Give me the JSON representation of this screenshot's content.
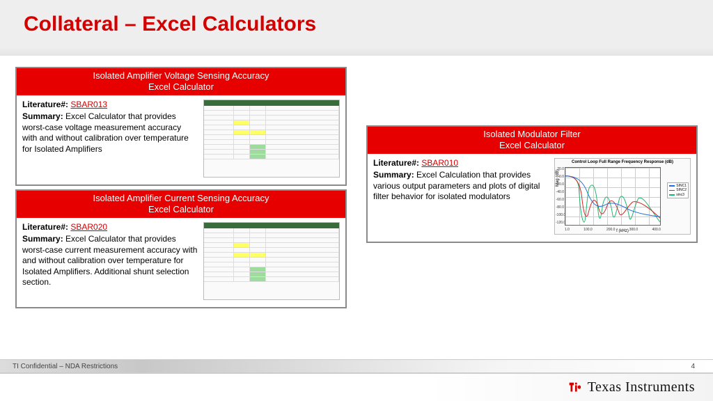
{
  "slide": {
    "title": "Collateral – Excel Calculators",
    "confidential": "TI Confidential – NDA Restrictions",
    "page_number": "4",
    "brand": "Texas Instruments"
  },
  "cards": [
    {
      "header_line1": "Isolated Amplifier Voltage Sensing Accuracy",
      "header_line2": "Excel Calculator",
      "literature_label": "Literature#:",
      "literature_id": "SBAR013",
      "summary_label": "Summary:",
      "summary_text": "Excel Calculator that provides worst-case voltage measurement accuracy with and without calibration over temperature for Isolated Amplifiers"
    },
    {
      "header_line1": "Isolated Amplifier Current Sensing Accuracy",
      "header_line2": "Excel Calculator",
      "literature_label": "Literature#:",
      "literature_id": "SBAR020",
      "summary_label": "Summary:",
      "summary_text": "Excel Calculator that provides worst-case current measurement accuracy with and without calibration over temperature for Isolated Amplifiers. Additional shunt selection section."
    },
    {
      "header_line1": "Isolated Modulator Filter",
      "header_line2": "Excel Calculator",
      "literature_label": "Literature#:",
      "literature_id": "SBAR010",
      "summary_label": "Summary:",
      "summary_text": "Excel Calculation that provides various output parameters and plots of digital filter behavior for isolated modulators"
    }
  ],
  "chart_data": {
    "type": "line",
    "title": "Control Loop Full Range Frequency Response  (dB)",
    "xlabel": "f (kHz)",
    "ylabel": "Mag (dB)",
    "x_ticks": [
      "1.0",
      "100.0",
      "200.0",
      "300.0",
      "400.0"
    ],
    "y_ticks": [
      "20.0",
      "0.0",
      "-20.0",
      "-40.0",
      "-60.0",
      "-80.0",
      "-100.0",
      "-120.0"
    ],
    "xlim": [
      1,
      400
    ],
    "ylim": [
      -120,
      20
    ],
    "series": [
      {
        "name": "SINC1",
        "color": "#1e6fd9"
      },
      {
        "name": "SINC2",
        "color": "#d42222"
      },
      {
        "name": "sinc3",
        "color": "#19b56a"
      }
    ]
  }
}
